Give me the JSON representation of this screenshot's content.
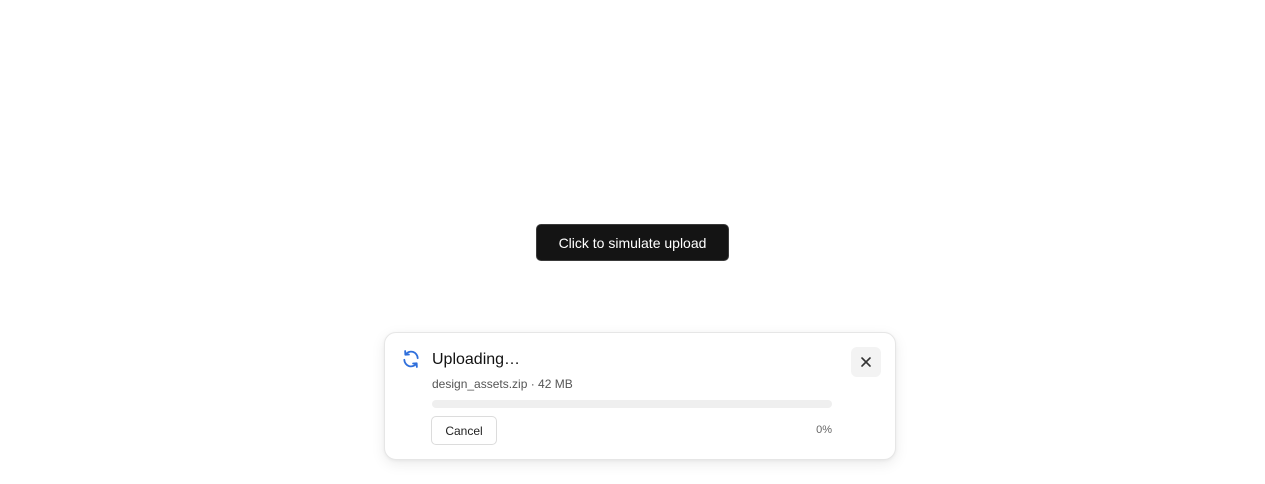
{
  "main": {
    "simulate_button_label": "Click to simulate upload"
  },
  "toast": {
    "icon": "refresh-icon",
    "title": "Uploading…",
    "file_info": "design_assets.zip · 42 MB",
    "progress_fraction": 0.0,
    "progress_text": "0%",
    "cancel_label": "Cancel",
    "close_icon": "close-icon",
    "accent_color": "#2f6fdb"
  }
}
